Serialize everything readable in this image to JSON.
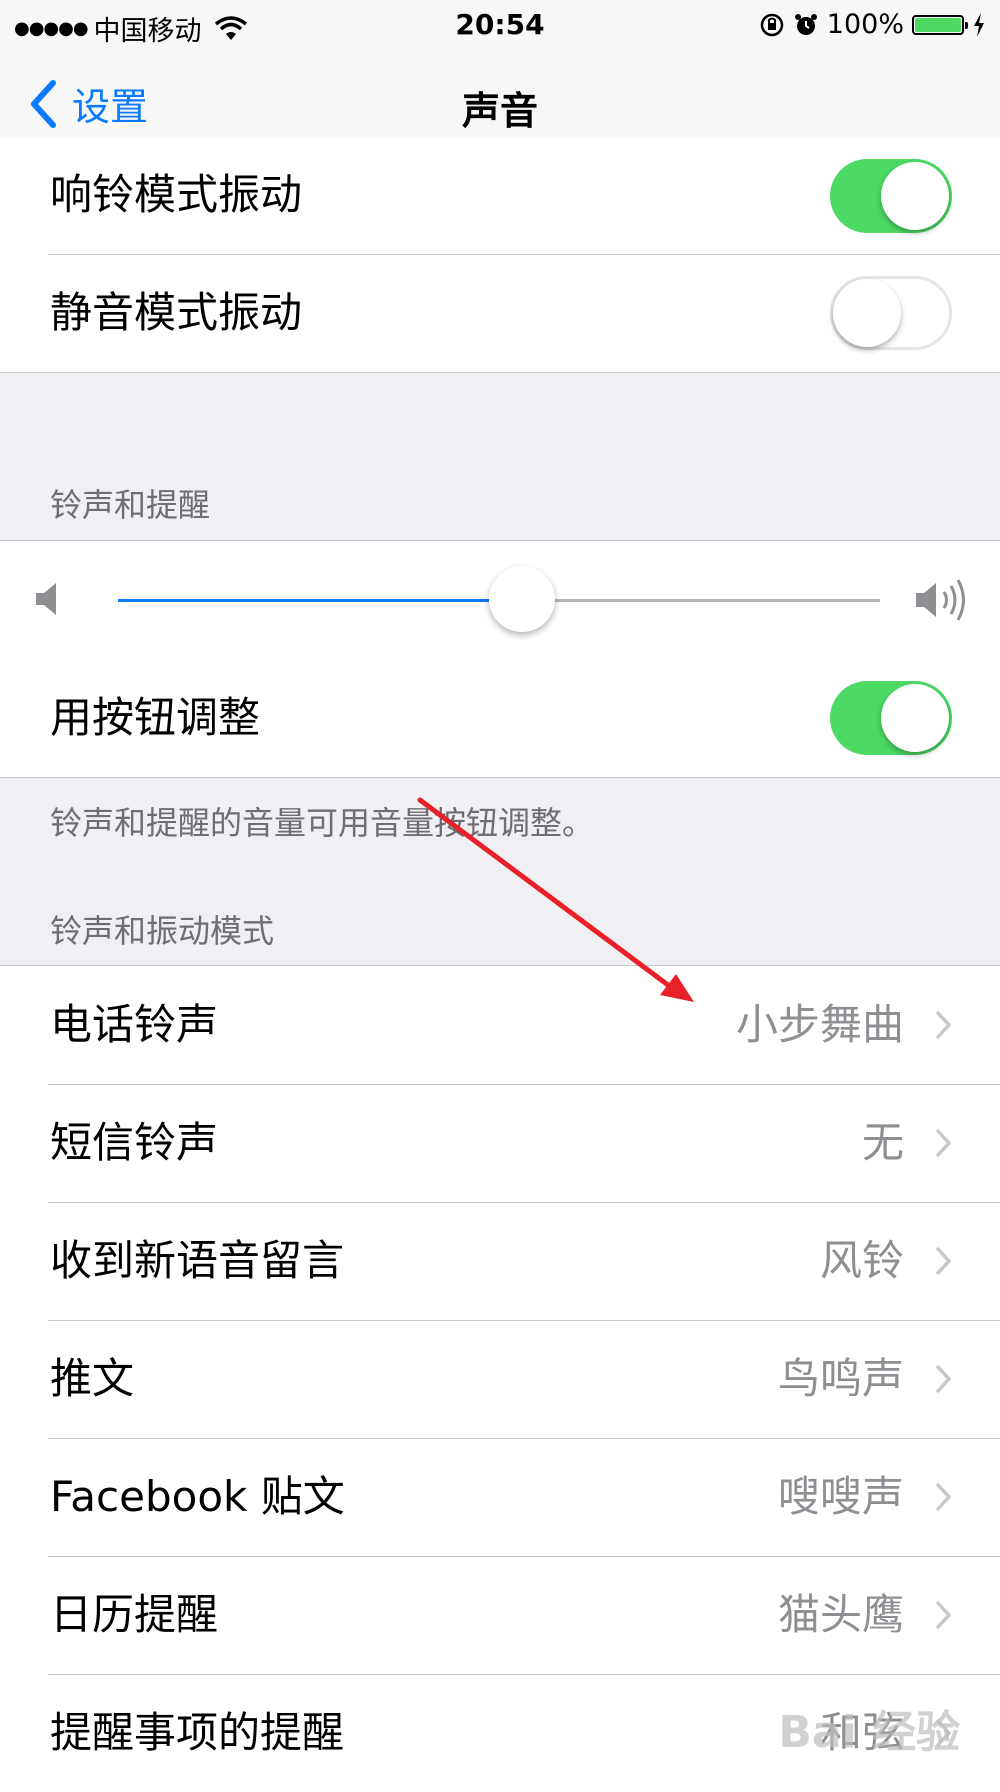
{
  "status_bar": {
    "signal": "●●●●●",
    "carrier": "中国移动",
    "time": "20:54",
    "battery": "100%",
    "battery_level": 1.0,
    "battery_color": "#4cd964"
  },
  "nav": {
    "back_label": "设置",
    "title": "声音"
  },
  "vibrate": {
    "ring_label": "响铃模式振动",
    "ring_on": true,
    "silent_label": "静音模式振动",
    "silent_on": false
  },
  "ringer": {
    "header": "铃声和提醒",
    "volume_level": 0.53,
    "buttons_label": "用按钮调整",
    "buttons_on": true,
    "footer": "铃声和提醒的音量可用音量按钮调整。"
  },
  "sounds": {
    "header": "铃声和振动模式",
    "items": [
      {
        "label": "电话铃声",
        "value": "小步舞曲"
      },
      {
        "label": "短信铃声",
        "value": "无"
      },
      {
        "label": "收到新语音留言",
        "value": "风铃"
      },
      {
        "label": "推文",
        "value": "鸟鸣声"
      },
      {
        "label": "Facebook 贴文",
        "value": "嗖嗖声"
      },
      {
        "label": "日历提醒",
        "value": "猫头鹰"
      },
      {
        "label": "提醒事项的提醒",
        "value": "和弦"
      }
    ]
  },
  "colors": {
    "accent": "#0a7aff",
    "toggle_on": "#4cd964",
    "annotation": "#e8202a"
  },
  "watermark": "Bai 经验"
}
